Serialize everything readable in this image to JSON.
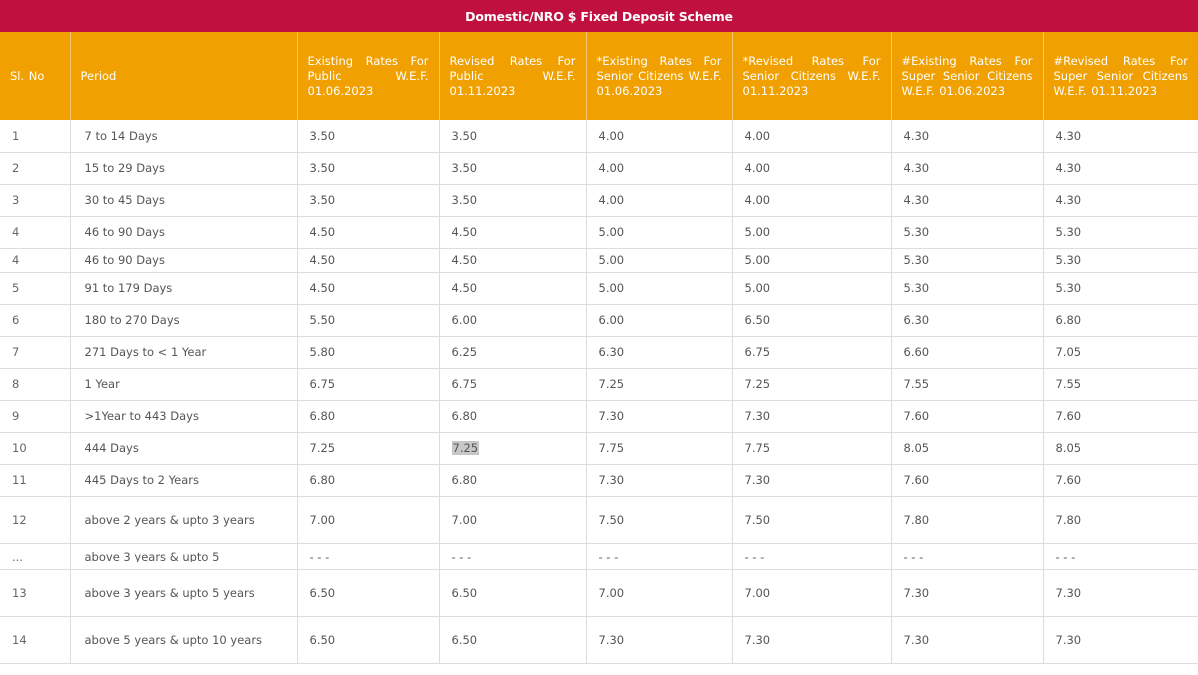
{
  "title": "Domestic/NRO $ Fixed Deposit Scheme",
  "headers": {
    "sl": "Sl. No",
    "period": "Period",
    "existing_public": "Existing Rates For Public W.E.F. 01.06.2023",
    "revised_public": "Revised Rates For Public W.E.F. 01.11.2023",
    "existing_senior": "*Existing Rates For Senior Citizens W.E.F. 01.06.2023",
    "revised_senior": "*Revised Rates For Senior Citizens W.E.F. 01.11.2023",
    "existing_super": "#Existing Rates For Super Senior Citizens W.E.F. 01.06.2023",
    "revised_super": "#Revised Rates For Super Senior Citizens W.E.F. 01.11.2023"
  },
  "rows": [
    {
      "sl": "1",
      "period": "7 to 14 Days",
      "r1": "3.50",
      "r2": "3.50",
      "r3": "4.00",
      "r4": "4.00",
      "r5": "4.30",
      "r6": "4.30"
    },
    {
      "sl": "2",
      "period": "15 to 29 Days",
      "r1": "3.50",
      "r2": "3.50",
      "r3": "4.00",
      "r4": "4.00",
      "r5": "4.30",
      "r6": "4.30"
    },
    {
      "sl": "3",
      "period": "30 to 45 Days",
      "r1": "3.50",
      "r2": "3.50",
      "r3": "4.00",
      "r4": "4.00",
      "r5": "4.30",
      "r6": "4.30"
    },
    {
      "sl": "4",
      "period": "46 to 90 Days",
      "r1": "4.50",
      "r2": "4.50",
      "r3": "5.00",
      "r4": "5.00",
      "r5": "5.30",
      "r6": "5.30"
    },
    {
      "sl": "4",
      "period": "46 to 90 Days",
      "r1": "4.50",
      "r2": "4.50",
      "r3": "5.00",
      "r4": "5.00",
      "r5": "5.30",
      "r6": "5.30"
    },
    {
      "sl": "5",
      "period": "91 to 179 Days",
      "r1": "4.50",
      "r2": "4.50",
      "r3": "5.00",
      "r4": "5.00",
      "r5": "5.30",
      "r6": "5.30"
    },
    {
      "sl": "6",
      "period": "180 to 270 Days",
      "r1": "5.50",
      "r2": "6.00",
      "r3": "6.00",
      "r4": "6.50",
      "r5": "6.30",
      "r6": "6.80"
    },
    {
      "sl": "7",
      "period": "271 Days to < 1 Year",
      "r1": "5.80",
      "r2": "6.25",
      "r3": "6.30",
      "r4": "6.75",
      "r5": "6.60",
      "r6": "7.05"
    },
    {
      "sl": "8",
      "period": "1 Year",
      "r1": "6.75",
      "r2": "6.75",
      "r3": "7.25",
      "r4": "7.25",
      "r5": "7.55",
      "r6": "7.55"
    },
    {
      "sl": "9",
      "period": ">1Year to 443 Days",
      "r1": "6.80",
      "r2": "6.80",
      "r3": "7.30",
      "r4": "7.30",
      "r5": "7.60",
      "r6": "7.60"
    },
    {
      "sl": "10",
      "period": "444 Days",
      "r1": "7.25",
      "r2": "7.25",
      "r3": "7.75",
      "r4": "7.75",
      "r5": "8.05",
      "r6": "8.05"
    },
    {
      "sl": "11",
      "period": "445 Days to 2 Years",
      "r1": "6.80",
      "r2": "6.80",
      "r3": "7.30",
      "r4": "7.30",
      "r5": "7.60",
      "r6": "7.60"
    },
    {
      "sl": "12",
      "period": "above 2 years & upto 3 years",
      "r1": "7.00",
      "r2": "7.00",
      "r3": "7.50",
      "r4": "7.50",
      "r5": "7.80",
      "r6": "7.80"
    },
    {
      "sl": "...",
      "period": "above 3 years & upto 5",
      "r1": "- - -",
      "r2": "- - -",
      "r3": "- - -",
      "r4": "- - -",
      "r5": "- - -",
      "r6": "- - -"
    },
    {
      "sl": "13",
      "period": "above 3 years & upto 5 years",
      "r1": "6.50",
      "r2": "6.50",
      "r3": "7.00",
      "r4": "7.00",
      "r5": "7.30",
      "r6": "7.30"
    },
    {
      "sl": "14",
      "period": "above 5 years & upto 10 years",
      "r1": "6.50",
      "r2": "6.50",
      "r3": "7.30",
      "r4": "7.30",
      "r5": "7.30",
      "r6": "7.30"
    }
  ]
}
